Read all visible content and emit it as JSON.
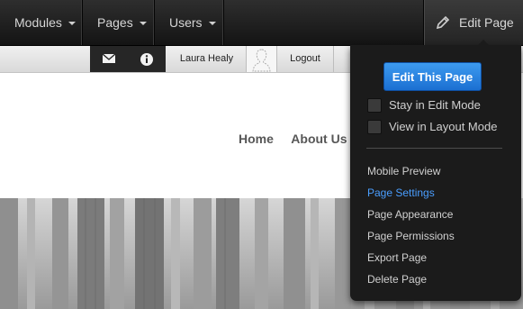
{
  "topbar": {
    "menus": [
      {
        "label": "Modules"
      },
      {
        "label": "Pages"
      },
      {
        "label": "Users"
      }
    ],
    "edit_page_label": "Edit Page"
  },
  "strip": {
    "user_name": "Laura Healy",
    "logout_label": "Logout"
  },
  "site_nav": [
    "Home",
    "About Us"
  ],
  "edit_panel": {
    "primary_button": "Edit This Page",
    "options": [
      {
        "label": "Stay in Edit Mode",
        "checked": false
      },
      {
        "label": "View in Layout Mode",
        "checked": false
      }
    ],
    "menu_items": [
      {
        "label": "Mobile Preview",
        "active": false
      },
      {
        "label": "Page Settings",
        "active": true
      },
      {
        "label": "Page Appearance",
        "active": false
      },
      {
        "label": "Page Permissions",
        "active": false
      },
      {
        "label": "Export Page",
        "active": false
      },
      {
        "label": "Delete Page",
        "active": false
      }
    ]
  },
  "colors": {
    "primary_button": "#2b87e3",
    "active_menu_item": "#4a9eff",
    "panel_background": "#1b1b1b"
  }
}
